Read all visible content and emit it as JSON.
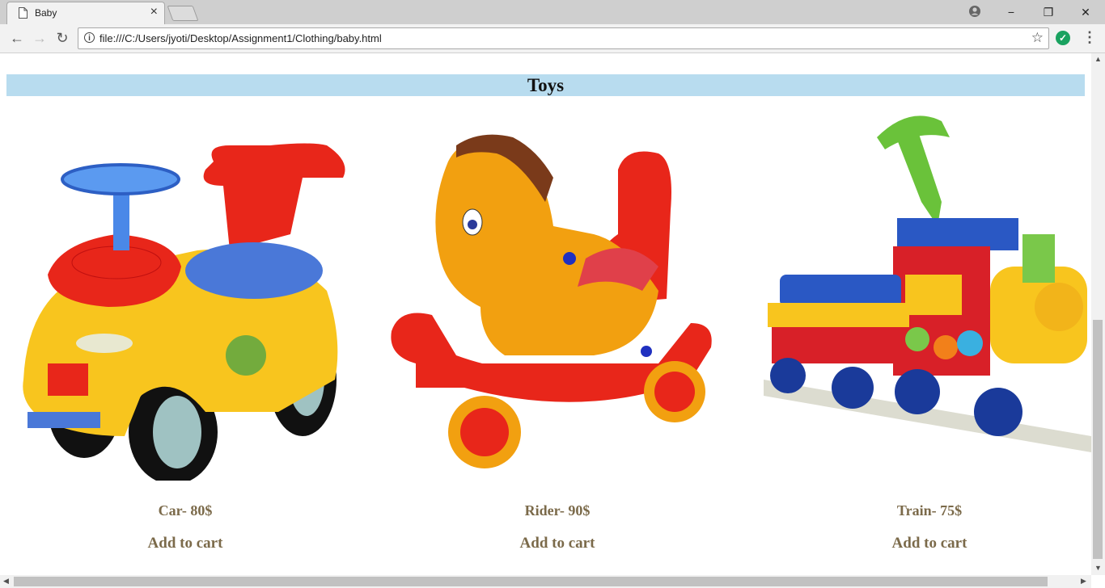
{
  "browser": {
    "tab_title": "Baby",
    "tab_close": "×",
    "url": "file:///C:/Users/jyoti/Desktop/Assignment1/Clothing/baby.html",
    "window_controls": {
      "minimize": "−",
      "restore": "❐",
      "close": "✕"
    },
    "nav": {
      "back": "←",
      "forward": "→",
      "reload": "↻"
    },
    "star": "☆",
    "extension_check": "✓",
    "menu": "⋮"
  },
  "page": {
    "section_title": "Toys",
    "products": [
      {
        "name": "Car- 80$",
        "action": "Add to cart",
        "icon": "ride-on-car-toy"
      },
      {
        "name": "Rider- 90$",
        "action": "Add to cart",
        "icon": "rocking-horse-toy"
      },
      {
        "name": "Train- 75$",
        "action": "Add to cart",
        "icon": "toy-train"
      }
    ]
  },
  "colors": {
    "section_bg": "#b8dcef",
    "product_text": "#7b6a4a"
  }
}
